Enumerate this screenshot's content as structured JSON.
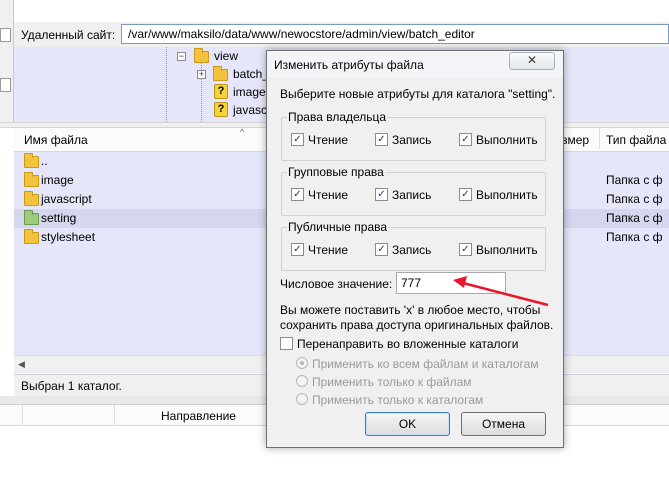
{
  "remote": {
    "label": "Удаленный сайт:",
    "path": "/var/www/maksilo/data/www/newocstore/admin/view/batch_editor"
  },
  "tree": {
    "items": [
      {
        "label": "view",
        "icon": "folder-icon"
      },
      {
        "label": "batch_",
        "icon": "folder-icon"
      },
      {
        "label": "image",
        "icon": "question-icon"
      },
      {
        "label": "javasc",
        "icon": "question-icon"
      }
    ]
  },
  "list": {
    "columns": {
      "name": "Имя файла",
      "size": "змер",
      "type": "Тип файла"
    },
    "rows": [
      {
        "name": "..",
        "type": ""
      },
      {
        "name": "image",
        "type": "Папка с ф"
      },
      {
        "name": "javascript",
        "type": "Папка с ф"
      },
      {
        "name": "setting",
        "type": "Папка с ф"
      },
      {
        "name": "stylesheet",
        "type": "Папка с ф"
      }
    ]
  },
  "status": {
    "text": "Выбран 1 каталог."
  },
  "queue": {
    "direction": "Направление"
  },
  "dialog": {
    "title": "Изменить атрибуты файла",
    "close": "✕",
    "prompt": "Выберите новые атрибуты для каталога \"setting\".",
    "groups": [
      {
        "title": "Права владельца",
        "read": "Чтение",
        "write": "Запись",
        "exec": "Выполнить"
      },
      {
        "title": "Групповые права",
        "read": "Чтение",
        "write": "Запись",
        "exec": "Выполнить"
      },
      {
        "title": "Публичные права",
        "read": "Чтение",
        "write": "Запись",
        "exec": "Выполнить"
      }
    ],
    "numeric_label": "Числовое значение:",
    "numeric_value": "777",
    "hint_line1": "Вы можете поставить 'x' в любое место, чтобы",
    "hint_line2": "сохранить права доступа оригинальных файлов.",
    "recurse_label": "Перенаправить во вложенные каталоги",
    "radio_all": "Применить ко всем файлам и каталогам",
    "radio_files": "Применить только к файлам",
    "radio_dirs": "Применить только к каталогам",
    "ok": "OK",
    "cancel": "Отмена"
  },
  "colors": {
    "list_bg": "#e6e6fa",
    "arrow": "#e8182a",
    "accent": "#3c7fb1"
  }
}
